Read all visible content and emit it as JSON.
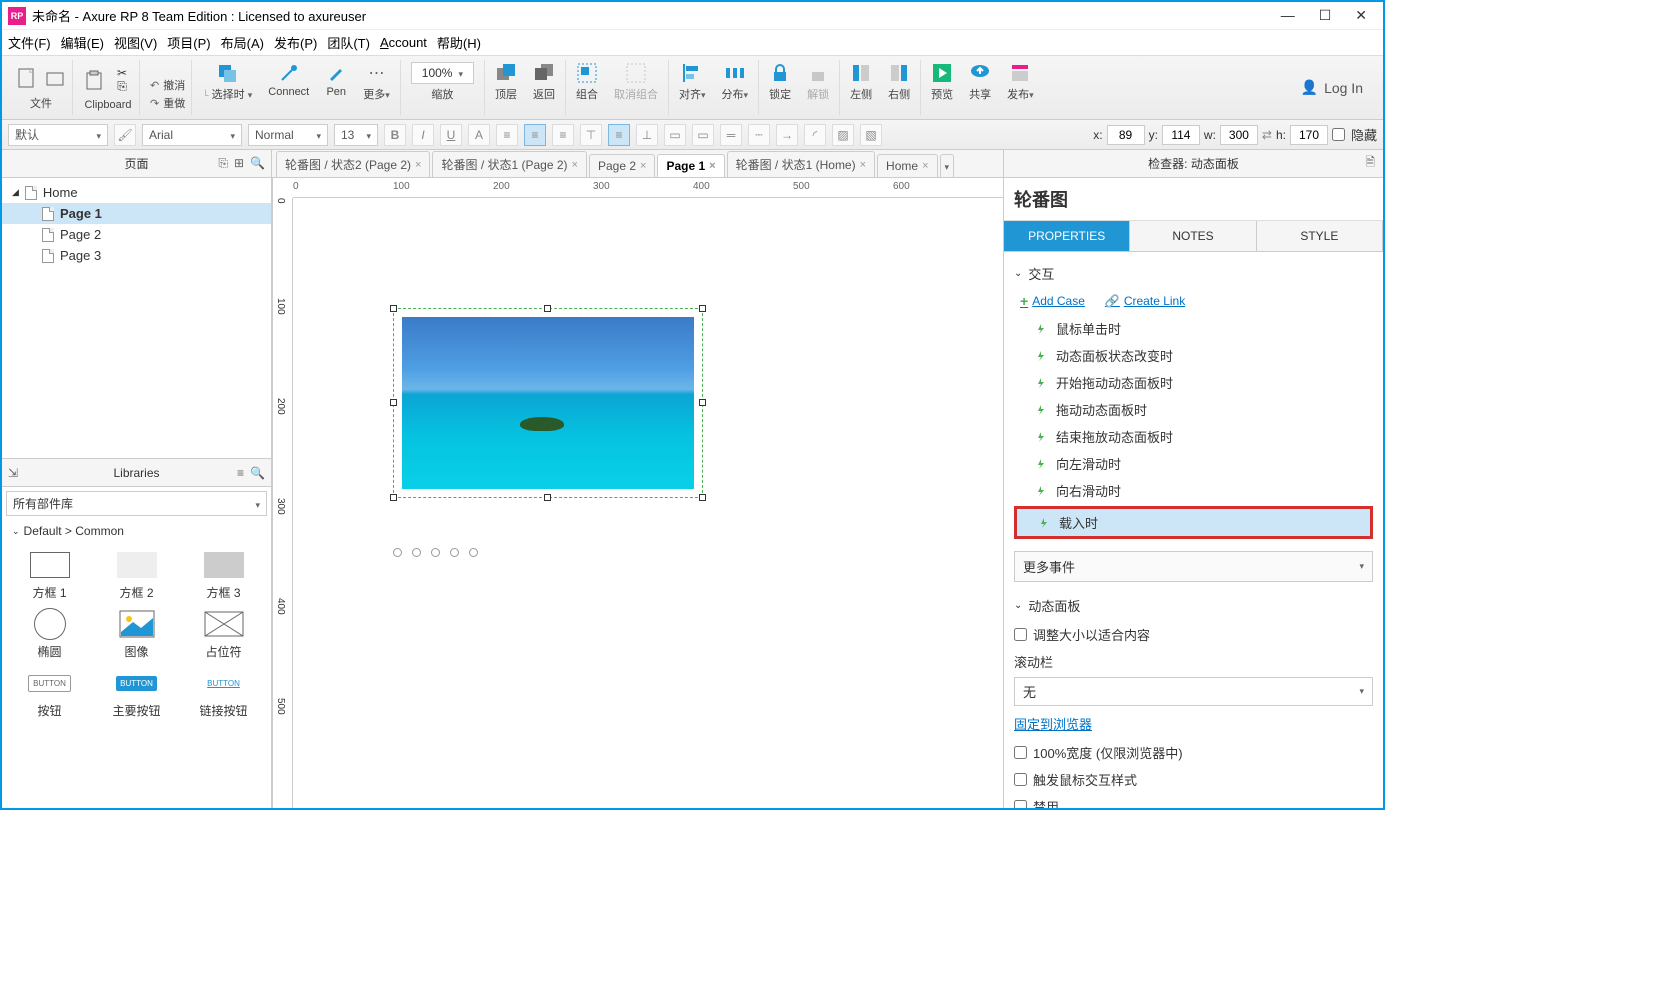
{
  "window": {
    "title": "未命名 - Axure RP 8 Team Edition : Licensed to axureuser"
  },
  "menu": {
    "file": "文件(F)",
    "edit": "编辑(E)",
    "view": "视图(V)",
    "project": "项目(P)",
    "arrange": "布局(A)",
    "publish": "发布(P)",
    "team": "团队(T)",
    "account": "Account",
    "help": "帮助(H)"
  },
  "toolbar": {
    "file": "文件",
    "clipboard": "Clipboard",
    "undo": "撤消",
    "redo": "重做",
    "select": "选择时",
    "connect": "Connect",
    "pen": "Pen",
    "more": "更多",
    "zoom": "100%",
    "zoomLbl": "缩放",
    "front": "顶层",
    "back": "返回",
    "group": "组合",
    "ungroup": "取消组合",
    "align": "对齐",
    "distribute": "分布",
    "lock": "锁定",
    "unlock": "解锁",
    "left": "左侧",
    "right": "右侧",
    "preview": "预览",
    "share": "共享",
    "publish": "发布",
    "login": "Log In"
  },
  "format": {
    "style": "默认",
    "font": "Arial",
    "weight": "Normal",
    "size": "13",
    "x": "89",
    "y": "114",
    "w": "300",
    "h": "170",
    "hidden": "隐藏"
  },
  "panels": {
    "pages": "页面",
    "libraries": "Libraries"
  },
  "tree": {
    "root": "Home",
    "children": [
      {
        "name": "Page 1",
        "sel": true
      },
      {
        "name": "Page 2"
      },
      {
        "name": "Page 3"
      }
    ]
  },
  "library": {
    "all": "所有部件库",
    "cat": "Default > Common",
    "items": [
      "方框 1",
      "方框 2",
      "方框 3",
      "椭圆",
      "图像",
      "占位符",
      "按钮",
      "主要按钮",
      "链接按钮"
    ]
  },
  "tabs": [
    {
      "name": "轮番图 / 状态2 (Page 2)"
    },
    {
      "name": "轮番图 / 状态1 (Page 2)"
    },
    {
      "name": "Page 2"
    },
    {
      "name": "Page 1",
      "active": true
    },
    {
      "name": "轮番图 / 状态1 (Home)"
    },
    {
      "name": "Home"
    }
  ],
  "ruler": {
    "h": [
      "0",
      "100",
      "200",
      "300",
      "400",
      "500",
      "600"
    ],
    "v": [
      "0",
      "100",
      "200",
      "300",
      "400",
      "500"
    ]
  },
  "inspector": {
    "header": "检查器: 动态面板",
    "title": "轮番图",
    "tabs": {
      "props": "PROPERTIES",
      "notes": "NOTES",
      "style": "STYLE"
    },
    "interactions": "交互",
    "addCase": "Add Case",
    "createLink": "Create Link",
    "events": [
      "鼠标单击时",
      "动态面板状态改变时",
      "开始拖动动态面板时",
      "拖动动态面板时",
      "结束拖放动态面板时",
      "向左滑动时",
      "向右滑动时"
    ],
    "eventSel": "载入时",
    "moreEvents": "更多事件",
    "dynpanel": "动态面板",
    "fitContent": "调整大小以适合内容",
    "scrollLbl": "滚动栏",
    "scrollVal": "无",
    "pinBrowser": "固定到浏览器",
    "fullWidth": "100%宽度 (仅限浏览器中)",
    "triggerHover": "触发鼠标交互样式",
    "disable": "禁用"
  }
}
